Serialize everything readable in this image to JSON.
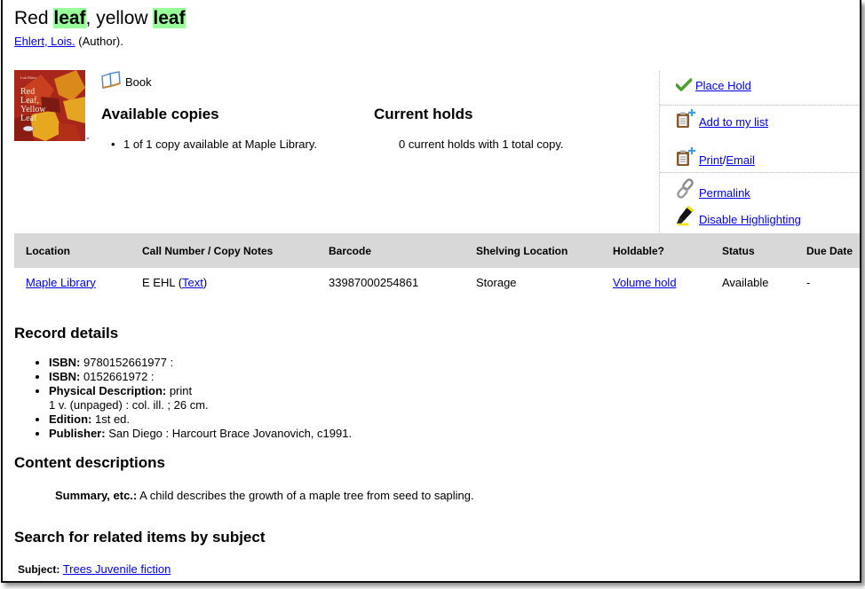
{
  "record": {
    "title_parts": [
      {
        "text": "Red ",
        "highlight": false
      },
      {
        "text": "leaf",
        "highlight": true
      },
      {
        "text": ", yellow ",
        "highlight": false
      },
      {
        "text": "leaf",
        "highlight": true
      }
    ],
    "author_link": "Ehlert, Lois.",
    "author_role": " (Author).",
    "cover_alt": "Red Leaf, Yellow Leaf",
    "cover_author": "Lois Ehlert",
    "cover_title_lines": [
      "Red",
      "Leaf,",
      "Yellow",
      "Leaf"
    ],
    "cover_link_dash": "-",
    "format_icon": "book-icon",
    "format_label": "Book"
  },
  "availability": {
    "available_heading": "Available copies",
    "available_text": "1 of 1 copy available at Maple Library.",
    "holds_heading": "Current holds",
    "holds_text": "0 current holds with 1 total copy."
  },
  "actions": {
    "place_hold": {
      "icon": "checkmark-icon",
      "label": " Place Hold"
    },
    "add_to_list": {
      "icon": "clipboard-add-icon",
      "label": " Add to my list"
    },
    "print": {
      "icon": "clipboard-add-icon",
      "label": " Print",
      "separator": " / ",
      "email_label": "Email"
    },
    "permalink": {
      "icon": "link-chain-icon",
      "label": " Permalink"
    },
    "highlight": {
      "icon": "highlighter-icon",
      "label": " Disable Highlighting"
    }
  },
  "holdings": {
    "headers": [
      "Location",
      "Call Number / Copy Notes",
      "Barcode",
      "Shelving Location",
      "Holdable?",
      "Status",
      "Due Date"
    ],
    "rows": [
      {
        "location": "Maple Library",
        "call_number": "E EHL (",
        "call_link": "Text",
        "call_close": ")",
        "barcode": "33987000254861",
        "shelving": "Storage",
        "holdable": "Volume hold",
        "status": "Available",
        "due_date": "-"
      }
    ]
  },
  "record_details": {
    "heading": "Record details",
    "items": [
      {
        "label": "ISBN:",
        "value": " 9780152661977 :"
      },
      {
        "label": "ISBN:",
        "value": " 0152661972 :"
      },
      {
        "label": "Physical Description:",
        "value": " print",
        "value2": "1 v. (unpaged) : col. ill. ; 26 cm."
      },
      {
        "label": "Edition:",
        "value": " 1st ed."
      },
      {
        "label": "Publisher:",
        "value": " San Diego : Harcourt Brace Jovanovich, c1991."
      }
    ]
  },
  "content": {
    "heading": "Content descriptions",
    "summary_label": "Summary, etc.:",
    "summary_text": " A child describes the growth of a maple tree from seed to sapling."
  },
  "subjects": {
    "heading": "Search for related items by subject",
    "label": "Subject:",
    "link": "Trees Juvenile fiction"
  },
  "colors": {
    "highlight": "#99ff99",
    "link": "#0000ee",
    "table_header_bg": "#d8d8d8"
  }
}
